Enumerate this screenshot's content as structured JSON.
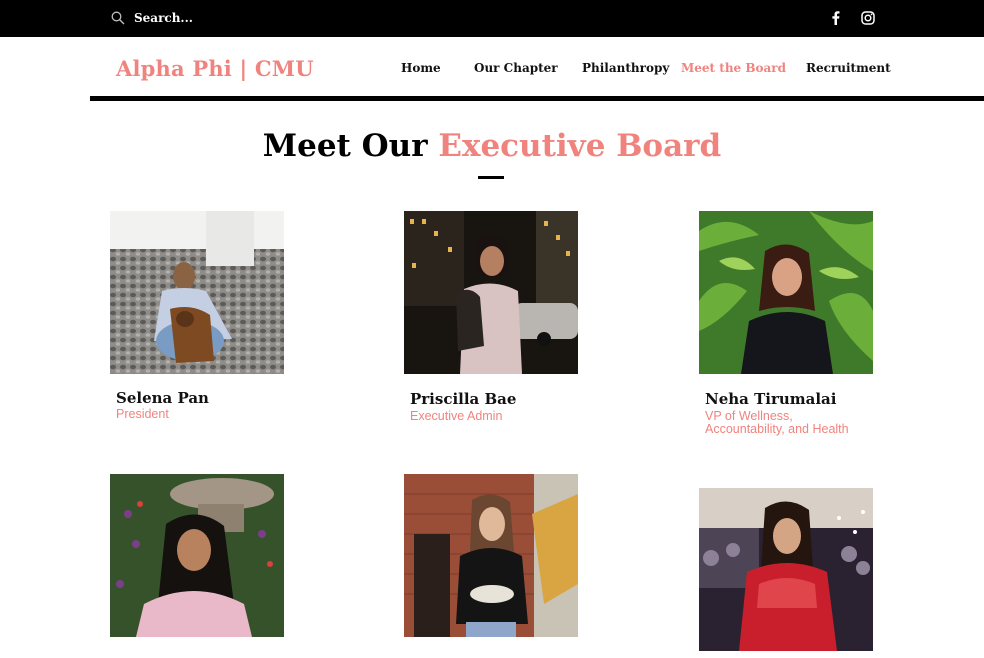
{
  "topbar": {
    "search_placeholder": "Search...",
    "social": [
      "facebook-icon",
      "instagram-icon"
    ]
  },
  "header": {
    "logo": "Alpha Phi | CMU",
    "nav": [
      {
        "label": "Home",
        "active": false
      },
      {
        "label": "Our Chapter",
        "active": false
      },
      {
        "label": "Philanthropy",
        "active": false
      },
      {
        "label": "Meet the Board",
        "active": true
      },
      {
        "label": "Recruitment",
        "active": false
      }
    ]
  },
  "main": {
    "heading_part1": "Meet Our",
    "heading_part2": "Executive Board",
    "members": [
      {
        "name": "Selena Pan",
        "role_line1": "President",
        "role_line2": ""
      },
      {
        "name": "Priscilla Bae",
        "role_line1": "Executive Admin",
        "role_line2": ""
      },
      {
        "name": "Neha Tirumalai",
        "role_line1": "VP of Wellness,",
        "role_line2": "Accountability, and Health"
      },
      {
        "name": "",
        "role_line1": "",
        "role_line2": ""
      },
      {
        "name": "",
        "role_line1": "",
        "role_line2": ""
      },
      {
        "name": "",
        "role_line1": "",
        "role_line2": ""
      }
    ]
  },
  "colors": {
    "accent": "#f0837e",
    "topbar": "#000000"
  }
}
